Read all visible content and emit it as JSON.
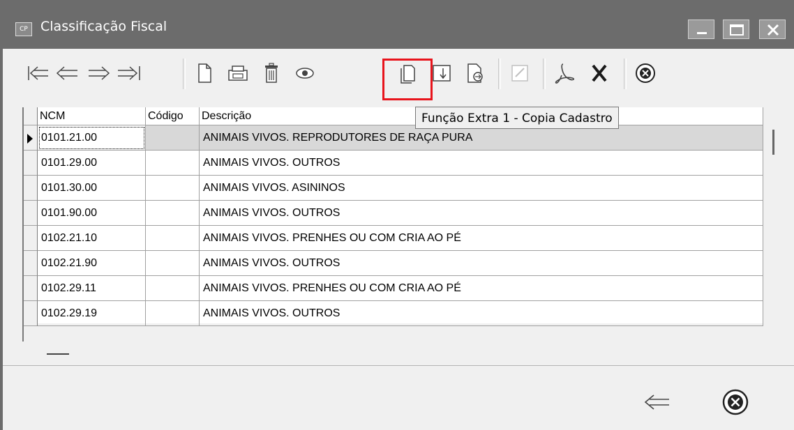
{
  "window": {
    "title": "Classificação Fiscal",
    "app_icon_text": "CP"
  },
  "toolbar": {
    "icons": [
      "first-record-icon",
      "previous-record-icon",
      "next-record-icon",
      "last-record-icon",
      "new-document-icon",
      "print-icon",
      "delete-icon",
      "view-icon",
      "copy-record-icon",
      "import-icon",
      "export-icon",
      "edit-icon",
      "pdf-icon",
      "excel-icon",
      "close-icon"
    ]
  },
  "tooltip": {
    "text": "Função Extra 1 - Copia Cadastro"
  },
  "grid": {
    "columns": [
      "NCM",
      "Código",
      "Descrição"
    ],
    "rows": [
      {
        "ncm": "0101.21.00",
        "codigo": "",
        "descricao": "ANIMAIS VIVOS. REPRODUTORES DE RAÇA PURA"
      },
      {
        "ncm": "0101.29.00",
        "codigo": "",
        "descricao": "ANIMAIS VIVOS. OUTROS"
      },
      {
        "ncm": "0101.30.00",
        "codigo": "",
        "descricao": "ANIMAIS VIVOS. ASININOS"
      },
      {
        "ncm": "0101.90.00",
        "codigo": "",
        "descricao": "ANIMAIS VIVOS. OUTROS"
      },
      {
        "ncm": "0102.21.10",
        "codigo": "",
        "descricao": "ANIMAIS VIVOS. PRENHES OU COM CRIA AO PÉ"
      },
      {
        "ncm": "0102.21.90",
        "codigo": "",
        "descricao": "ANIMAIS VIVOS. OUTROS"
      },
      {
        "ncm": "0102.29.11",
        "codigo": "",
        "descricao": "ANIMAIS VIVOS. PRENHES OU COM CRIA AO PÉ"
      },
      {
        "ncm": "0102.29.19",
        "codigo": "",
        "descricao": "ANIMAIS VIVOS. OUTROS"
      }
    ]
  },
  "colors": {
    "titlebar": "#6c6c6c",
    "highlight": "#e8141c",
    "selected_row": "#d8d8d8"
  }
}
